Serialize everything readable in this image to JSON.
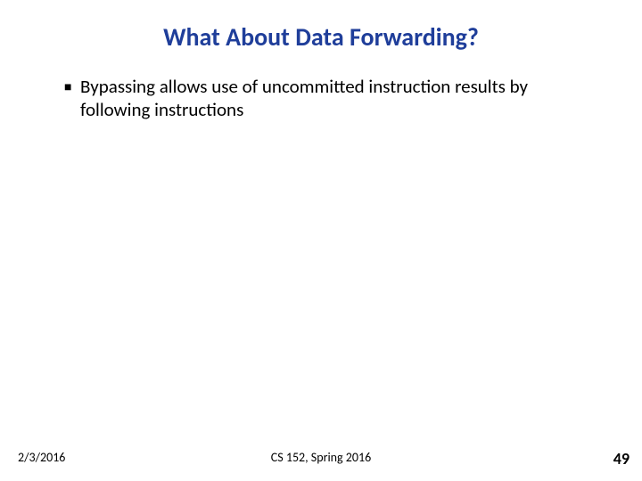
{
  "title": "What About Data Forwarding?",
  "bullets": [
    {
      "marker": "■",
      "text": "Bypassing allows use of uncommitted instruction results by following instructions"
    }
  ],
  "footer": {
    "date": "2/3/2016",
    "center": "CS 152, Spring 2016",
    "page": "49"
  }
}
